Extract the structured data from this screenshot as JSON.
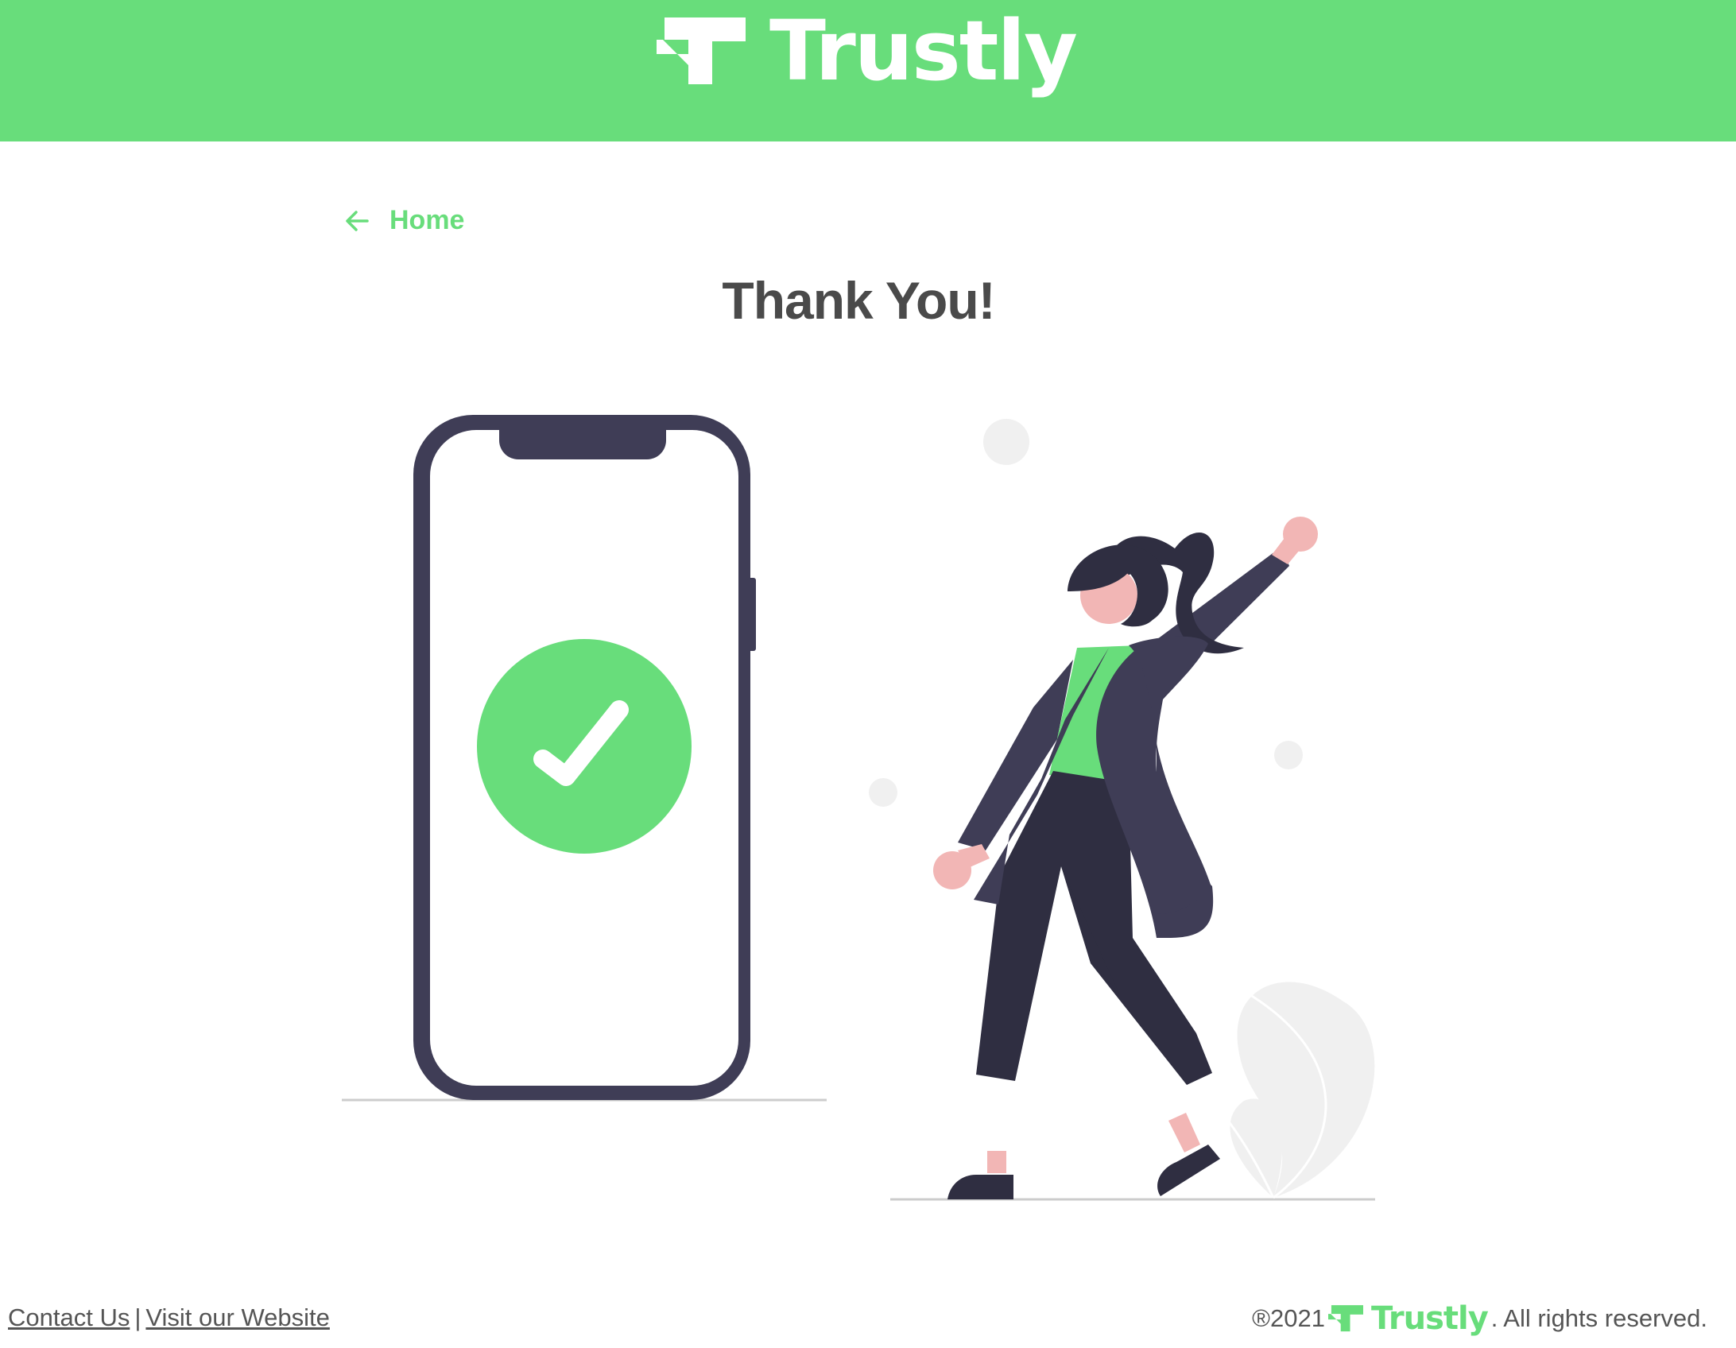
{
  "colors": {
    "brand_green": "#68dd7b",
    "phone_frame": "#3f3d56",
    "dark_clothing": "#2f2e41",
    "skin": "#f2b6b5",
    "decor_gray": "#f0f0f0",
    "ground": "#cccccc"
  },
  "header": {
    "logo_icon": "trustly-logo-icon",
    "logo_text": "Trustly"
  },
  "nav": {
    "back_icon": "arrow-left-icon",
    "home_label": "Home"
  },
  "main": {
    "title": "Thank You!",
    "success_icon": "checkmark-icon"
  },
  "footer": {
    "contact_label": "Contact Us",
    "separator": "|",
    "website_label": "Visit our Website",
    "copyright_prefix": "®2021",
    "logo_text": "Trustly",
    "rights_text": ". All rights reserved."
  }
}
